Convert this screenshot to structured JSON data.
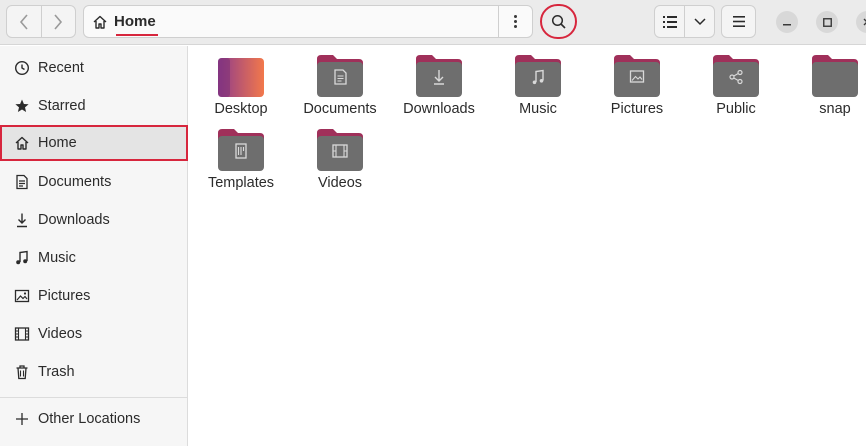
{
  "header": {
    "path_label": "Home",
    "icons": {
      "back": "chevron-left-icon",
      "forward": "chevron-right-icon",
      "home": "home-icon",
      "path_menu": "kebab-menu-icon",
      "search": "search-icon",
      "view_list": "list-view-icon",
      "view_options": "chevron-down-icon",
      "main_menu": "hamburger-menu-icon",
      "minimize": "minimize-icon",
      "maximize": "maximize-icon",
      "close": "close-icon"
    }
  },
  "sidebar": {
    "items": [
      {
        "label": "Recent",
        "icon": "clock-icon"
      },
      {
        "label": "Starred",
        "icon": "star-icon"
      },
      {
        "label": "Home",
        "icon": "home-icon",
        "active": true
      },
      {
        "label": "Documents",
        "icon": "document-icon"
      },
      {
        "label": "Downloads",
        "icon": "download-icon"
      },
      {
        "label": "Music",
        "icon": "music-icon"
      },
      {
        "label": "Pictures",
        "icon": "picture-icon"
      },
      {
        "label": "Videos",
        "icon": "film-icon"
      },
      {
        "label": "Trash",
        "icon": "trash-icon"
      }
    ],
    "other_locations": {
      "label": "Other Locations",
      "icon": "plus-icon"
    }
  },
  "files": [
    {
      "label": "Desktop",
      "icon": "desktop-folder-icon"
    },
    {
      "label": "Documents",
      "icon": "documents-folder-icon"
    },
    {
      "label": "Downloads",
      "icon": "downloads-folder-icon"
    },
    {
      "label": "Music",
      "icon": "music-folder-icon"
    },
    {
      "label": "Pictures",
      "icon": "pictures-folder-icon"
    },
    {
      "label": "Public",
      "icon": "public-folder-icon"
    },
    {
      "label": "snap",
      "icon": "folder-icon"
    },
    {
      "label": "Templates",
      "icon": "templates-folder-icon"
    },
    {
      "label": "Videos",
      "icon": "videos-folder-icon"
    }
  ],
  "colors": {
    "highlight": "#d7263d",
    "folder_tab": "#a0305a",
    "folder_body": "#6e6e6e",
    "desktop_gradient_start": "#8e3b8c",
    "desktop_gradient_end": "#f2784b"
  }
}
